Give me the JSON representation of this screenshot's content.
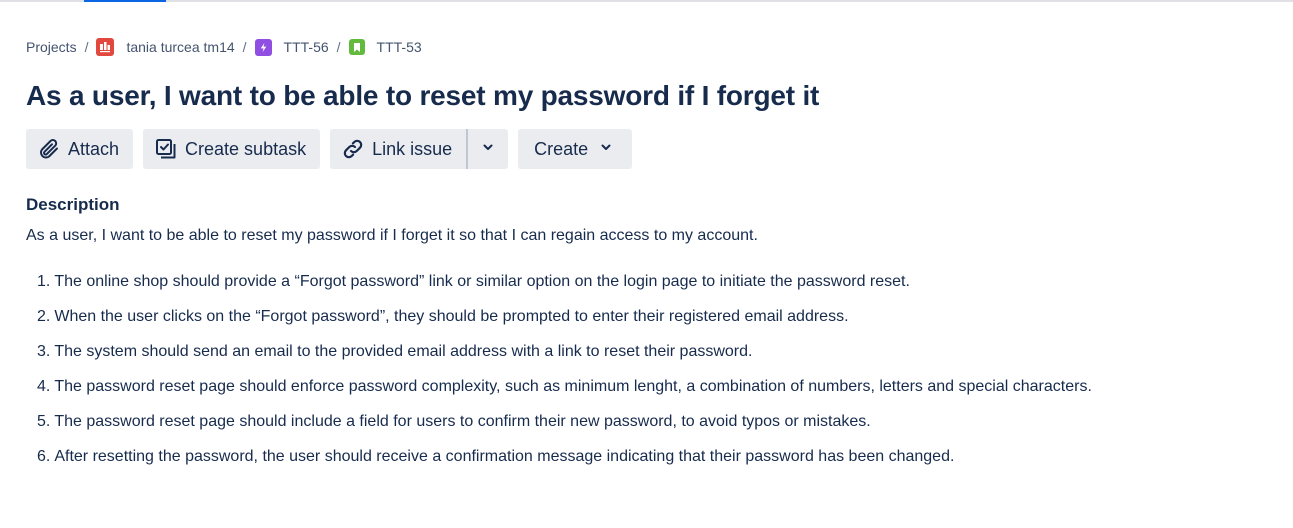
{
  "breadcrumb": {
    "projects": "Projects",
    "project": "tania turcea tm14",
    "epic": "TTT-56",
    "story": "TTT-53",
    "separator": "/"
  },
  "issue": {
    "title": "As a user, I want to be able to reset my password if I forget it"
  },
  "toolbar": {
    "attach": "Attach",
    "create_subtask": "Create subtask",
    "link_issue": "Link issue",
    "create": "Create"
  },
  "description": {
    "label": "Description",
    "text": "As a user, I want to be able to reset my password if I forget it  so that I can regain access to my account.",
    "items": [
      {
        "num": "1.",
        "text": "The online shop should provide a “Forgot password” link or similar option on the login page to initiate the password reset."
      },
      {
        "num": "2.",
        "text": "When the user clicks on the “Forgot password”, they should be prompted to enter their registered email address."
      },
      {
        "num": "3.",
        "text": "The system should send an email to the provided email address with a link to reset their password."
      },
      {
        "num": "4.",
        "text": "The password reset page should enforce password complexity, such as minimum lenght, a combination of numbers, letters and special characters."
      },
      {
        "num": "5.",
        "text": "The password reset page should include a field for users to confirm their new password, to avoid typos or mistakes."
      },
      {
        "num": "6.",
        "text": "After resetting the password, the user should receive a confirmation message indicating that their password has been changed."
      }
    ]
  },
  "icons": {
    "project": "project-avatar-icon",
    "epic": "epic-lightning-icon",
    "story": "story-bookmark-icon",
    "attach": "paperclip-icon",
    "subtask": "subtask-checkbox-icon",
    "link": "link-icon",
    "chevron": "chevron-down-icon"
  },
  "colors": {
    "project_icon": "#e2483d",
    "epic_icon": "#904ee2",
    "story_icon": "#63ba3c",
    "button_bg": "#ebecf0",
    "text": "#172b4d"
  }
}
